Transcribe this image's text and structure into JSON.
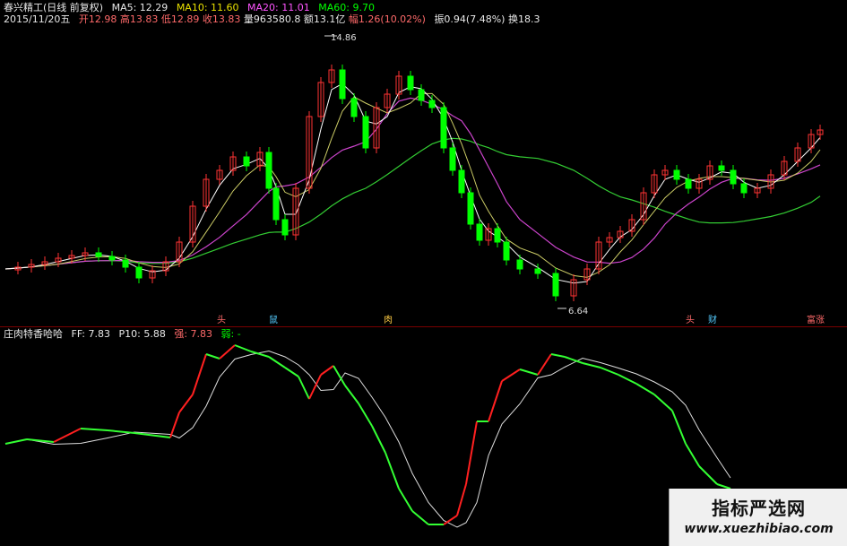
{
  "header": {
    "stock_title": "春兴精工(日线 前复权)",
    "ma5_label": "MA5: 12.29",
    "ma10_label": "MA10: 11.60",
    "ma20_label": "MA20: 11.01",
    "ma60_label": "MA60: 9.70"
  },
  "quote": {
    "date": "2015/11/20五",
    "open": "开12.98",
    "high": "高13.83",
    "low": "低12.89",
    "close": "收13.83",
    "volume": "量963580.8",
    "amount": "额13.1亿",
    "change_pct": "幅1.26(10.02%)",
    "amplitude": "振0.94(7.48%)",
    "turnover": "换18.3"
  },
  "markers": {
    "high_price": "14.86",
    "low_price": "6.64",
    "tag_1": "头",
    "tag_2": "鼠",
    "tag_3": "肉",
    "tag_4": "头",
    "tag_5": "财",
    "tag_6": "富涨"
  },
  "indicator": {
    "name": "庄肉特香哈哈",
    "ff_label": "FF: 7.83",
    "p10_label": "P10: 5.88",
    "strong_label": "强: 7.83",
    "weak_label": "弱: -"
  },
  "watermark": {
    "title": "指标严选网",
    "url": "www.xuezhibiao.com"
  },
  "colors": {
    "up_candle": "#ff3333",
    "down_candle": "#00ff00",
    "ma5": "#ffffff",
    "ma10": "#cccc66",
    "ma20": "#cc44cc",
    "ma60": "#33cc33",
    "ff_line_strong": "#ff2020",
    "ff_line_weak": "#33ff33",
    "p10_line": "#dddddd"
  }
}
